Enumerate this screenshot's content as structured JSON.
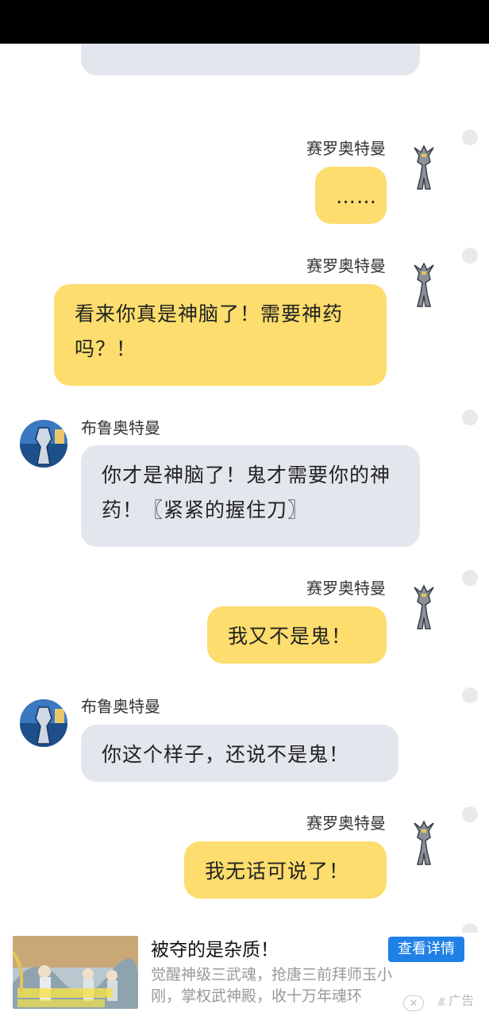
{
  "chat": {
    "names": {
      "mine": "赛罗奥特曼",
      "theirs": "布鲁奥特曼"
    },
    "messages": [
      {
        "sender": "mine",
        "text": "……"
      },
      {
        "sender": "mine",
        "text": "看来你真是神脑了！需要神药吗？！"
      },
      {
        "sender": "theirs",
        "text": "你才是神脑了！鬼才需要你的神药！〖紧紧的握住刀〗"
      },
      {
        "sender": "mine",
        "text": "我又不是鬼！"
      },
      {
        "sender": "theirs",
        "text": "你这个样子，还说不是鬼！"
      },
      {
        "sender": "mine",
        "text": "我无话可说了！"
      }
    ]
  },
  "ad": {
    "title": "被夺的是杂质！",
    "description": "觉醒神级三武魂，抢唐三前拜师玉小刚，掌权武神殿，收十万年魂环",
    "button_label": "查看详情",
    "close_icon": "close-icon",
    "tag_label": "广告"
  },
  "colors": {
    "mine_bubble": "#fcdd6d",
    "theirs_bubble": "#e3e6ed",
    "ad_button": "#1f80e6"
  }
}
